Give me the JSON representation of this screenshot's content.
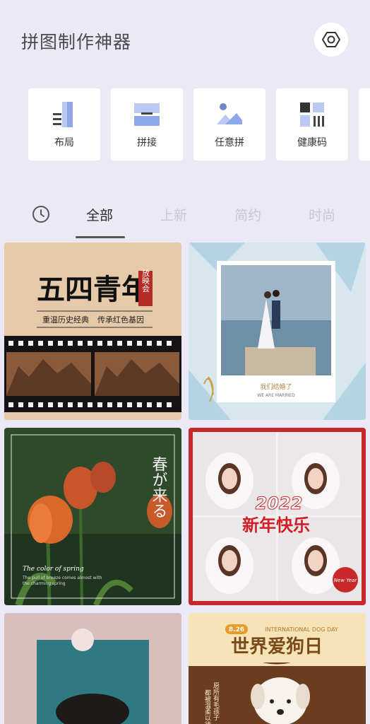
{
  "header": {
    "title": "拼图制作神器"
  },
  "tools": [
    {
      "label": "布局",
      "icon": "layout-icon"
    },
    {
      "label": "拼接",
      "icon": "stitch-icon"
    },
    {
      "label": "任意拼",
      "icon": "freestyle-icon"
    },
    {
      "label": "健康码",
      "icon": "health-code-icon"
    }
  ],
  "tabs": [
    {
      "label": "全部",
      "active": true
    },
    {
      "label": "上新"
    },
    {
      "label": "简约"
    },
    {
      "label": "时尚"
    }
  ],
  "templates": {
    "t1": {
      "headline": "五四青年",
      "badge": "放映会",
      "slogan_left": "重温历史经典",
      "slogan_right": "传承红色基因"
    },
    "t2": {
      "caption_cn": "我们结婚了",
      "caption_en": "WE ARE MARRIED"
    },
    "t3": {
      "vertical_text": "春が来る",
      "caption_title": "The color of spring",
      "caption_line1": "The pull of breeze comes almost with",
      "caption_line2": "the charming spring"
    },
    "t4": {
      "year": "2022",
      "greeting": "新年快乐",
      "sticker": "New Year"
    },
    "t5": {},
    "t6": {
      "date": "8.26",
      "event_en": "INTERNATIONAL DOG DAY",
      "headline": "世界爱狗日",
      "side_text": [
        "愿所有毛孩子",
        "都被温柔以待"
      ]
    }
  },
  "colors": {
    "background": "#ebe9f5",
    "card": "#ffffff",
    "accent_red": "#c8282a"
  }
}
